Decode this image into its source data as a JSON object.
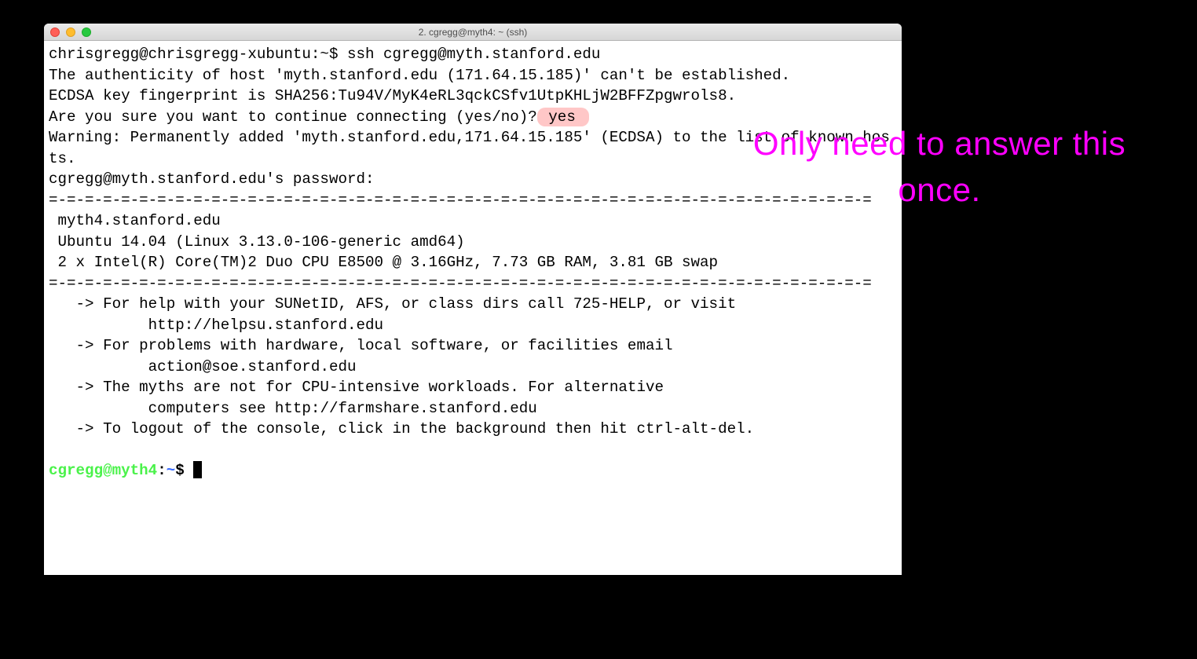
{
  "window": {
    "title": "2. cgregg@myth4: ~ (ssh)"
  },
  "terminal": {
    "line1_prompt": "chrisgregg@chrisgregg-xubuntu:~$ ",
    "line1_cmd": "ssh cgregg@myth.stanford.edu",
    "line2": "The authenticity of host 'myth.stanford.edu (171.64.15.185)' can't be established.",
    "line3": "ECDSA key fingerprint is SHA256:Tu94V/MyK4eRL3qckCSfv1UtpKHLjW2BFFZpgwrols8.",
    "line4_q": "Are you sure you want to continue connecting (yes/no)?",
    "line4_ans": " yes ",
    "line5": "Warning: Permanently added 'myth.stanford.edu,171.64.15.185' (ECDSA) to the list of known hosts.",
    "line6": "cgregg@myth.stanford.edu's password: ",
    "sep": "=-=-=-=-=-=-=-=-=-=-=-=-=-=-=-=-=-=-=-=-=-=-=-=-=-=-=-=-=-=-=-=-=-=-=-=-=-=-=-=-=-=-=-=-=-=",
    "motd1": " myth4.stanford.edu",
    "motd2": " Ubuntu 14.04 (Linux 3.13.0-106-generic amd64)",
    "motd3": " 2 x Intel(R) Core(TM)2 Duo CPU E8500 @ 3.16GHz, 7.73 GB RAM, 3.81 GB swap",
    "help1": "   -> For help with your SUNetID, AFS, or class dirs call 725-HELP, or visit",
    "help1b": "           http://helpsu.stanford.edu",
    "help2": "   -> For problems with hardware, local software, or facilities email",
    "help2b": "           action@soe.stanford.edu",
    "help3": "   -> The myths are not for CPU-intensive workloads. For alternative",
    "help3b": "           computers see http://farmshare.stanford.edu",
    "help4": "   -> To logout of the console, click in the background then hit ctrl-alt-del.",
    "prompt2_user": "cgregg@myth4",
    "prompt2_colon": ":",
    "prompt2_path": "~",
    "prompt2_dollar": "$ "
  },
  "annotation": {
    "text": "Only need to answer this once."
  }
}
